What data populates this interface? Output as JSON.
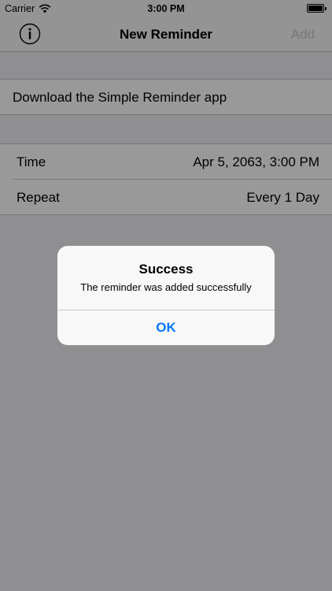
{
  "status_bar": {
    "carrier": "Carrier",
    "time": "3:00 PM"
  },
  "nav": {
    "info_icon": "info-circle-icon",
    "title": "New Reminder",
    "add_label": "Add"
  },
  "reminder": {
    "text": "Download the Simple Reminder app"
  },
  "settings": [
    {
      "label": "Time",
      "value": "Apr 5, 2063, 3:00 PM"
    },
    {
      "label": "Repeat",
      "value": "Every 1 Day"
    }
  ],
  "alert": {
    "title": "Success",
    "message": "The reminder was added successfully",
    "ok_label": "OK"
  },
  "colors": {
    "accent": "#007aff",
    "disabled": "#c7c7cc"
  }
}
